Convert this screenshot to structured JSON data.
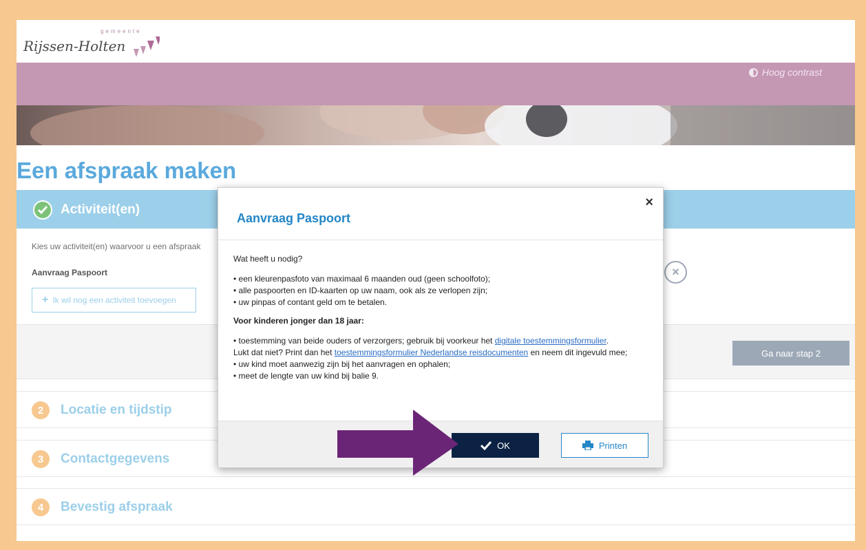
{
  "header": {
    "logo_small": "gemeente",
    "logo_main": "Rijssen-Holten",
    "contrast_label": "Hoog contrast"
  },
  "page": {
    "title": "Een afspraak maken"
  },
  "step1": {
    "title": "Activiteit(en)",
    "intro": "Kies uw activiteit(en) waarvoor u een afspraak",
    "activity": "Aanvraag Paspoort",
    "add_label": "Ik wil nog een activiteit toevoegen",
    "next_label": "Ga naar stap 2"
  },
  "steps": [
    {
      "num": "2",
      "label": "Locatie en tijdstip"
    },
    {
      "num": "3",
      "label": "Contactgegevens"
    },
    {
      "num": "4",
      "label": "Bevestig afspraak"
    }
  ],
  "modal": {
    "title": "Aanvraag Paspoort",
    "close": "×",
    "question": "Wat heeft u nodig?",
    "items": [
      "• een kleurenpasfoto van maximaal 6 maanden oud (geen schoolfoto);",
      "• alle paspoorten en ID-kaarten op uw naam, ook als ze verlopen zijn;",
      "• uw pinpas of contant geld om te betalen."
    ],
    "children_heading": "Voor kinderen jonger dan 18 jaar:",
    "children_p1_a": "• toestemming van beide ouders of verzorgers; gebruik bij voorkeur het ",
    "children_link1": "digitale toestemmingsformulier",
    "children_p1_b": ".",
    "children_p2_a": "Lukt dat niet? Print dan het ",
    "children_link2": "toestemmingsformulier Nederlandse reisdocumenten",
    "children_p2_b": " en neem dit ingevuld mee;",
    "children_p3": "• uw kind moet aanwezig zijn bij het aanvragen en ophalen;",
    "children_p4": "• meet de lengte van uw kind bij balie 9.",
    "ok_label": "OK",
    "print_label": "Printen"
  },
  "colors": {
    "accent_blue": "#9ccfe9",
    "modal_title": "#2386c6",
    "ok_button": "#0c2244",
    "arrow": "#6b2576",
    "frame": "#f7c88f"
  }
}
